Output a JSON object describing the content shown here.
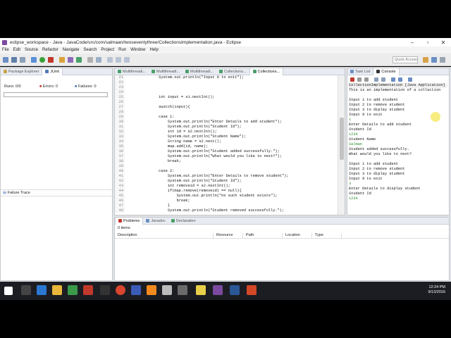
{
  "window": {
    "title": "eclipse_workspace - Java - JavaCode/src/com/salmaan/twoseventythree/CollectionsImplementation.java - Eclipse"
  },
  "menu": [
    "File",
    "Edit",
    "Source",
    "Refactor",
    "Navigate",
    "Search",
    "Project",
    "Run",
    "Window",
    "Help"
  ],
  "quick_access_placeholder": "Quick Access",
  "left_panel": {
    "tabs": [
      "Package Explorer",
      "JUnit"
    ],
    "runs_label": "Runs:",
    "runs_value": "0/0",
    "errors_label": "Errors:",
    "errors_value": "0",
    "failures_label": "Failures:",
    "failures_value": "0",
    "failure_trace_label": "Failure Trace"
  },
  "editor": {
    "tabs": [
      "Multithreadi...",
      "Multithreadi...",
      "Multithreadi...",
      "Collections...",
      "Collections..."
    ],
    "lines": [
      {
        "n": "21",
        "t": "            System.out.println(\"Input 9 to exit\");"
      },
      {
        "n": "22",
        "t": ""
      },
      {
        "n": "23",
        "t": ""
      },
      {
        "n": "24",
        "t": ""
      },
      {
        "n": "25",
        "t": "            int input = s1.nextInt();"
      },
      {
        "n": "26",
        "t": ""
      },
      {
        "n": "27",
        "t": "            switch(input){"
      },
      {
        "n": "28",
        "t": ""
      },
      {
        "n": "29",
        "t": "            case 1:"
      },
      {
        "n": "30",
        "t": "                System.out.println(\"Enter Details to add student\");"
      },
      {
        "n": "31",
        "t": "                System.out.println(\"Student Id\");"
      },
      {
        "n": "32",
        "t": "                int id = s2.nextInt();"
      },
      {
        "n": "33",
        "t": "                System.out.println(\"Student Name\");"
      },
      {
        "n": "34",
        "t": "                String name = s2.next();"
      },
      {
        "n": "35",
        "t": "                map.add(id, name);"
      },
      {
        "n": "36",
        "t": "                System.out.println(\"Student added successfully.\");"
      },
      {
        "n": "37",
        "t": "                System.out.println(\"What would you like to next?\");"
      },
      {
        "n": "38",
        "t": "                break;"
      },
      {
        "n": "39",
        "t": ""
      },
      {
        "n": "40",
        "t": "            case 2:"
      },
      {
        "n": "41",
        "t": "                System.out.println(\"Enter Details to remove student\");"
      },
      {
        "n": "42",
        "t": "                System.out.println(\"Student Id\");"
      },
      {
        "n": "43",
        "t": "                int removeid = s2.nextInt();"
      },
      {
        "n": "44",
        "t": "                if(map.remove(removeid) == null){"
      },
      {
        "n": "45",
        "t": "                    System.out.println(\"no such student exists\");"
      },
      {
        "n": "46",
        "t": "                    break;"
      },
      {
        "n": "47",
        "t": "                }"
      },
      {
        "n": "48",
        "t": "                System.out.println(\"Student removed successfully.\");"
      }
    ]
  },
  "console": {
    "tabs": [
      "Task List",
      "Console"
    ],
    "process_title": "CollectionImplementation [Java Application] C:\\Program Files\\Java",
    "lines": [
      {
        "t": "This is an implementation of a collection",
        "kind": "out"
      },
      {
        "t": "",
        "kind": "out"
      },
      {
        "t": "Input 1 to add student",
        "kind": "out"
      },
      {
        "t": "Input 2 to remove student",
        "kind": "out"
      },
      {
        "t": "Input 3 to diplay student",
        "kind": "out"
      },
      {
        "t": "Input 9 to exit",
        "kind": "out"
      },
      {
        "t": "1",
        "kind": "input"
      },
      {
        "t": "Enter Details to add student",
        "kind": "out"
      },
      {
        "t": "Student Id",
        "kind": "out"
      },
      {
        "t": "1234",
        "kind": "input"
      },
      {
        "t": "Student Name",
        "kind": "out"
      },
      {
        "t": "Salman",
        "kind": "input"
      },
      {
        "t": "Student added successfully.",
        "kind": "out"
      },
      {
        "t": "What would you like to next?",
        "kind": "out"
      },
      {
        "t": "",
        "kind": "out"
      },
      {
        "t": "Input 1 to add student",
        "kind": "out"
      },
      {
        "t": "Input 2 to remove student",
        "kind": "out"
      },
      {
        "t": "Input 3 to diplay student",
        "kind": "out"
      },
      {
        "t": "Input 9 to exit",
        "kind": "out"
      },
      {
        "t": "3",
        "kind": "input"
      },
      {
        "t": "Enter Details to display student",
        "kind": "out"
      },
      {
        "t": "Student Id",
        "kind": "out"
      },
      {
        "t": "1234",
        "kind": "input"
      }
    ]
  },
  "problems": {
    "tabs": [
      "Problems",
      "Javadoc",
      "Declaration"
    ],
    "count": "0 items",
    "columns": [
      "Description",
      "Resource",
      "Path",
      "Location",
      "Type"
    ]
  },
  "taskbar": {
    "time": "12:24 PM",
    "date": "9/13/2016"
  },
  "colors": {
    "accent": "#7b4aa0",
    "console_input": "#2a8a2a"
  }
}
